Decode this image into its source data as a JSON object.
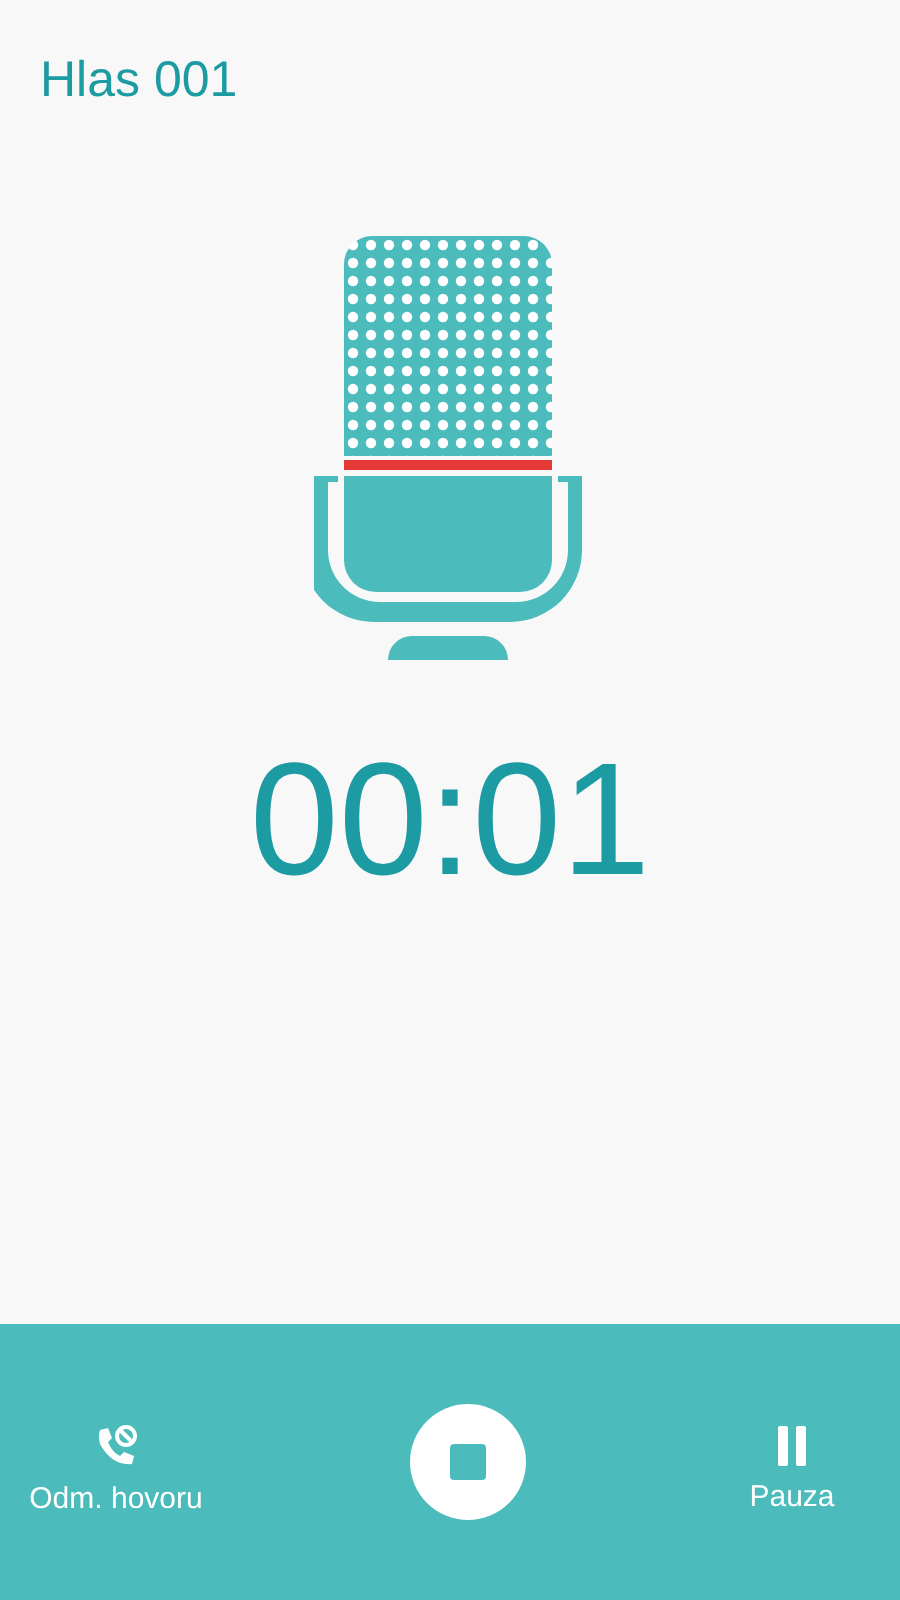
{
  "title": "Hlas 001",
  "timer": "00:01",
  "bottom_bar": {
    "left": {
      "label": "Odm. hovoru"
    },
    "right": {
      "label": "Pauza"
    }
  }
}
